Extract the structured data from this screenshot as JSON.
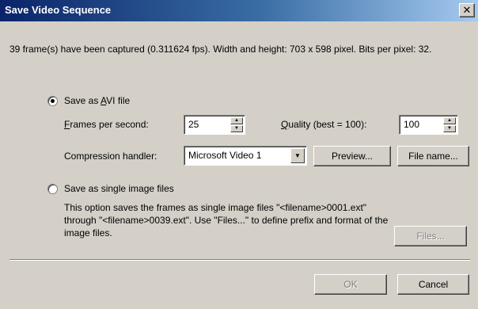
{
  "window": {
    "title": "Save Video Sequence",
    "close_label": "✕"
  },
  "info": "39 frame(s) have been captured (0.311624 fps). Width and height: 703 x 598 pixel. Bits per pixel: 32.",
  "avi": {
    "label_prefix": "Save as ",
    "label_accel": "A",
    "label_suffix": "VI file",
    "selected": true,
    "fps_accel": "F",
    "fps_rest": "rames per second:",
    "fps_value": "25",
    "quality_accel": "Q",
    "quality_rest": "uality (best = 100):",
    "quality_value": "100",
    "compression_label": "Compression handler:",
    "compression_value": "Microsoft Video 1",
    "preview_label": "Preview...",
    "filename_label": "File name..."
  },
  "images": {
    "label": "Save as single image files",
    "selected": false,
    "description": "This option saves the frames as single image files \"<filename>0001.ext\" through \"<filename>0039.ext\". Use \"Files...\" to define prefix and format of the image files.",
    "files_label": "Files..."
  },
  "footer": {
    "ok_label": "OK",
    "cancel_label": "Cancel"
  },
  "colors": {
    "titlebar_start": "#0a246a",
    "titlebar_end": "#a6caf0",
    "face": "#d4d0c8"
  },
  "icons": {
    "spin_up": "▲",
    "spin_down": "▼",
    "dropdown": "▼"
  }
}
